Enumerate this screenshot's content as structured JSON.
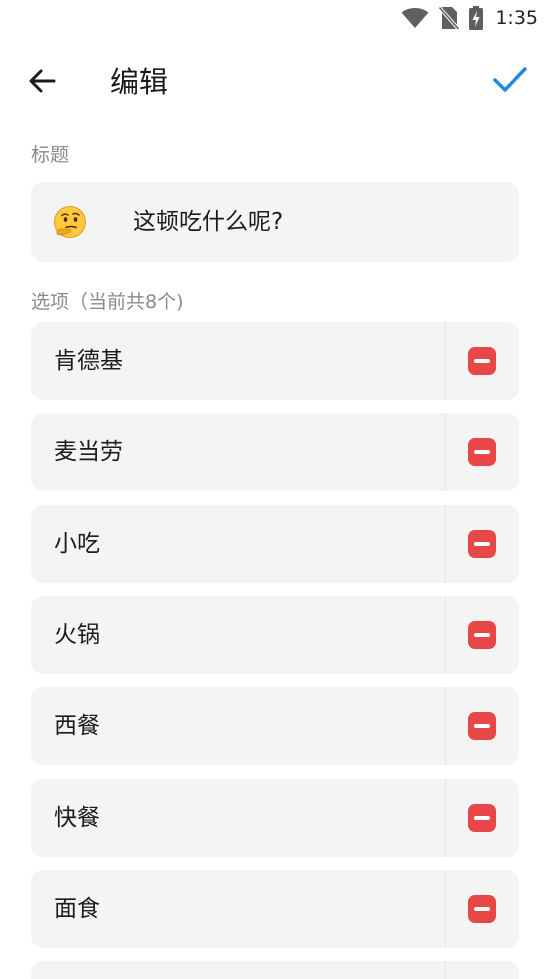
{
  "status_bar": {
    "time": "1:35",
    "icons": [
      "wifi-icon",
      "no-sim-icon",
      "battery-charging-icon"
    ]
  },
  "app_bar": {
    "title": "编辑",
    "back_icon": "arrow-left-icon",
    "confirm_icon": "check-icon"
  },
  "title_section": {
    "label": "标题",
    "emoji": "🤔",
    "value": "这顿吃什么呢?"
  },
  "options_section": {
    "label": "选项（当前共8个)",
    "items": [
      {
        "label": "肯德基"
      },
      {
        "label": "麦当劳"
      },
      {
        "label": "小吃"
      },
      {
        "label": "火锅"
      },
      {
        "label": "西餐"
      },
      {
        "label": "快餐"
      },
      {
        "label": "面食"
      },
      {
        "label": ""
      }
    ]
  },
  "colors": {
    "accent": "#1e88e5",
    "remove": "#e84747",
    "card_bg": "#f4f4f4",
    "label_gray": "#8a8a8a"
  }
}
